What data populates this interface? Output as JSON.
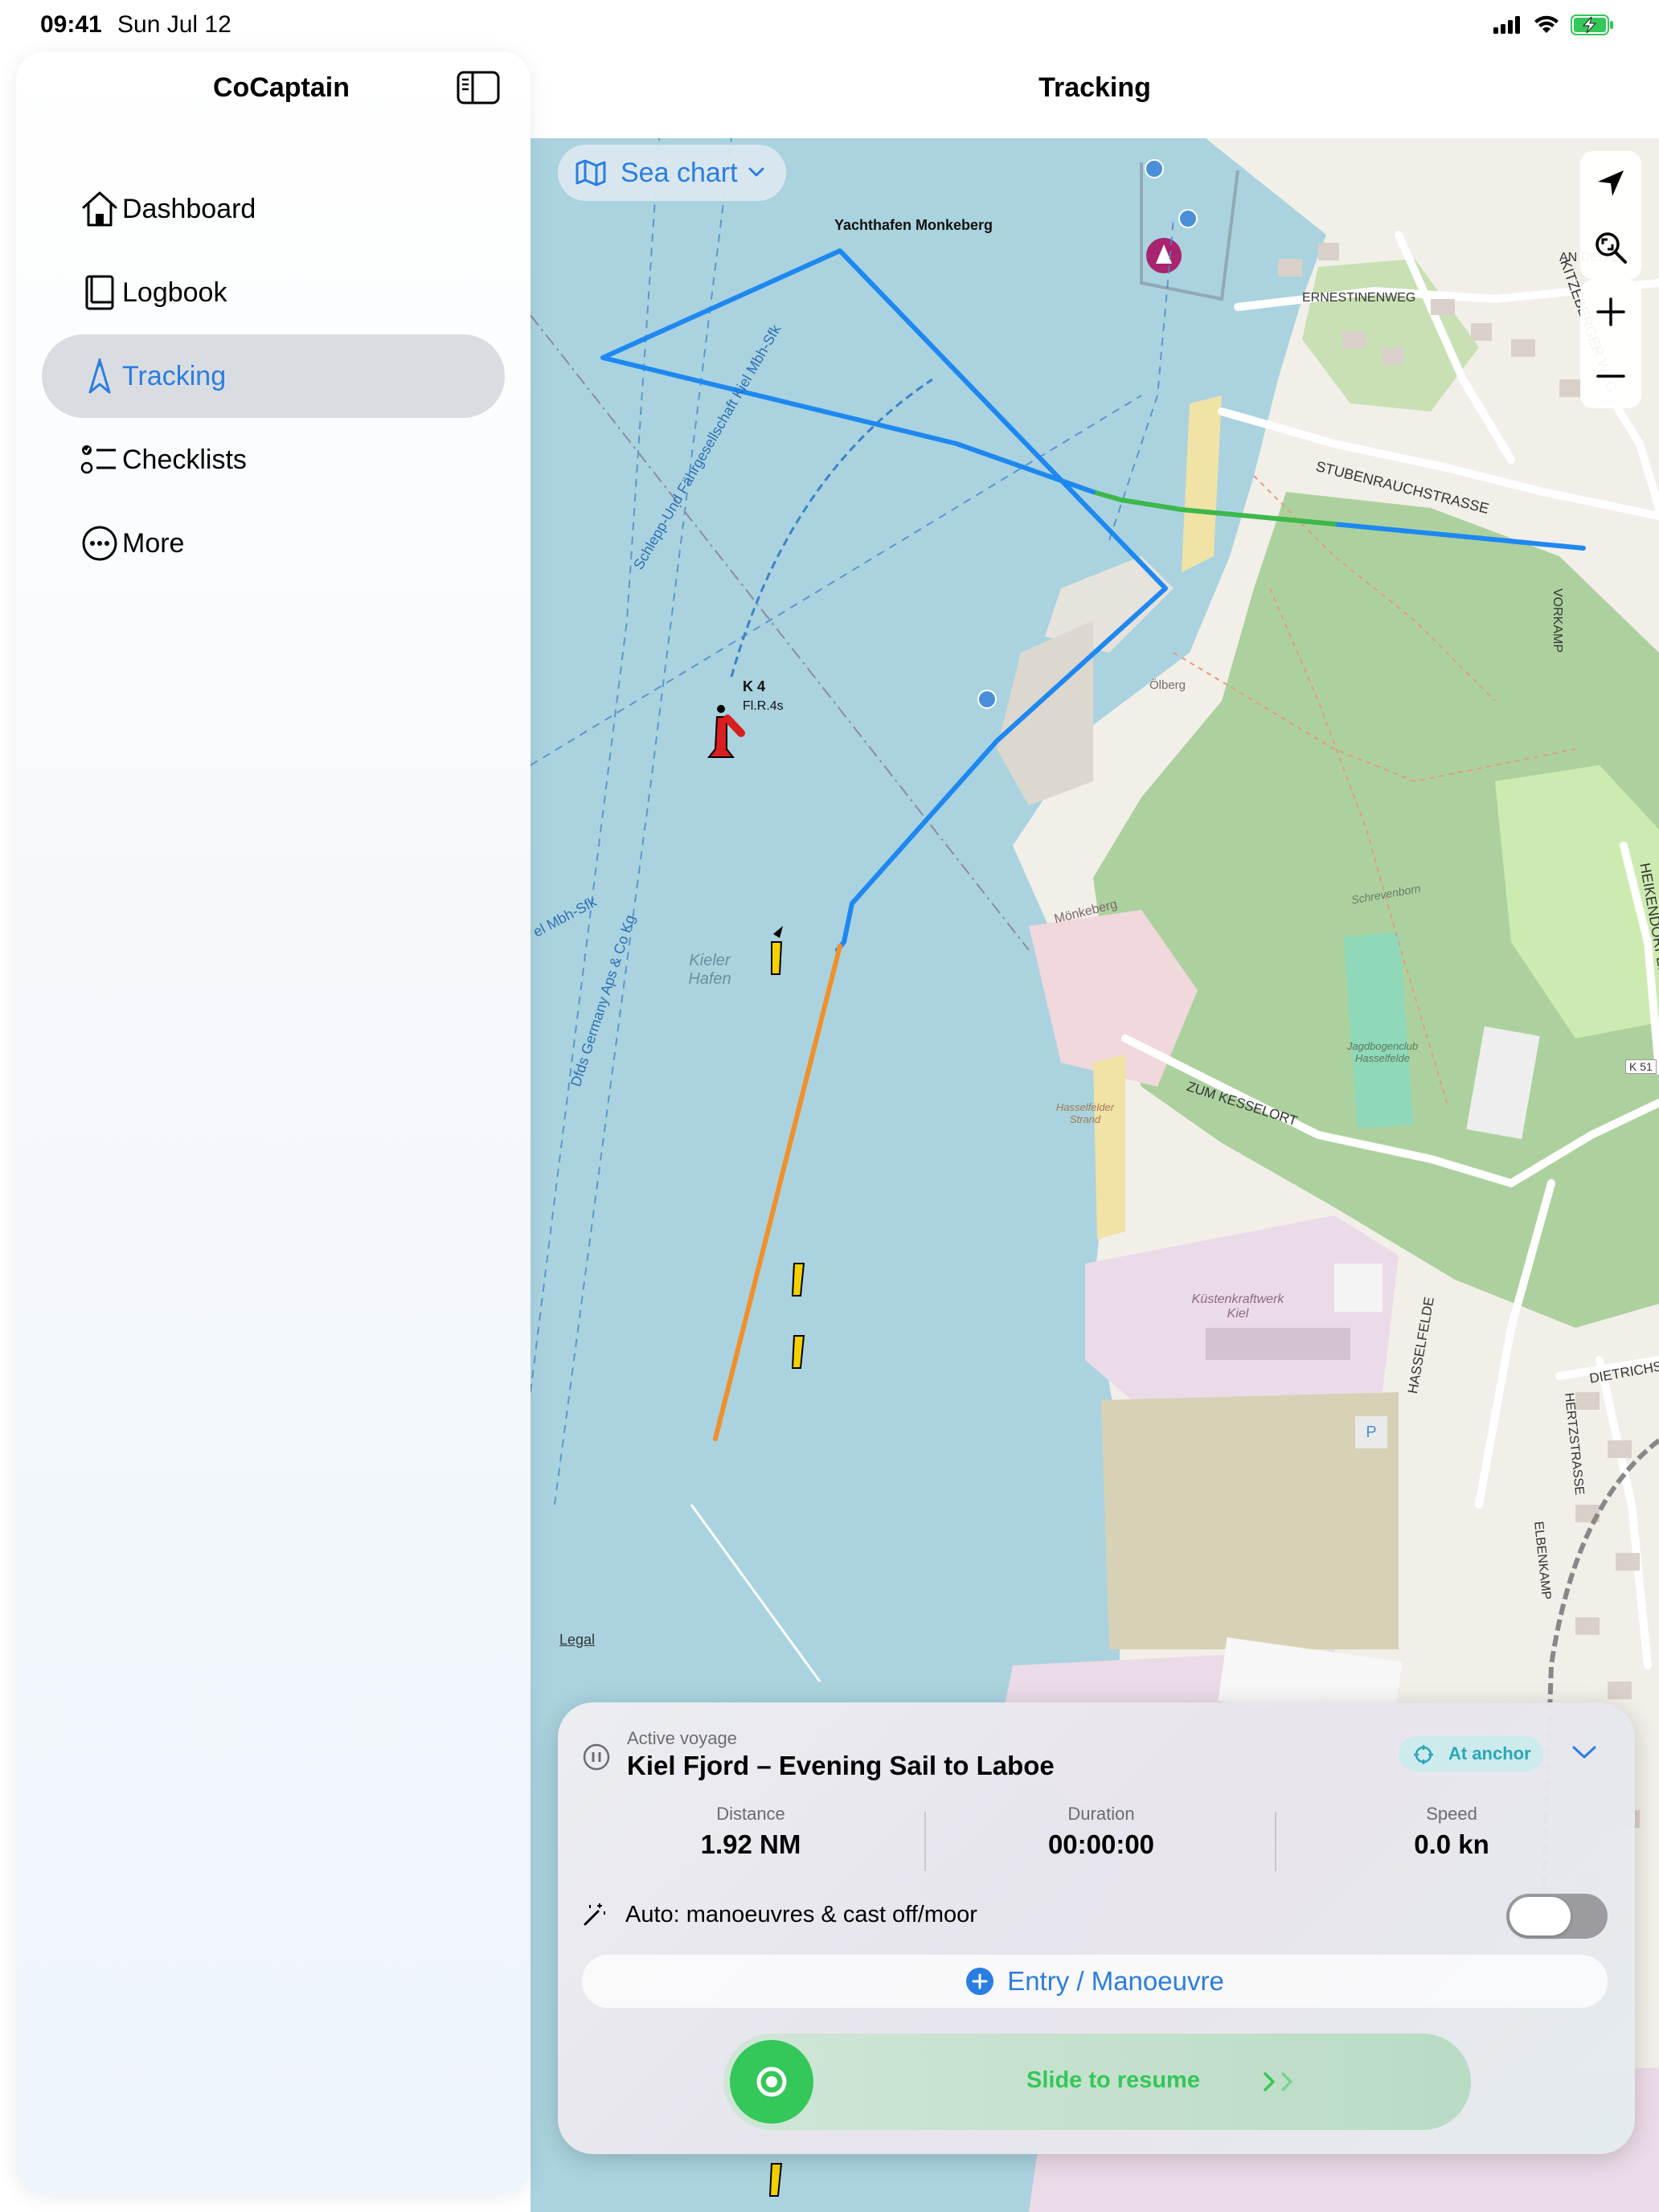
{
  "status": {
    "time": "09:41",
    "date": "Sun Jul 12"
  },
  "sidebar": {
    "title": "CoCaptain",
    "items": [
      {
        "label": "Dashboard",
        "icon": "house-icon"
      },
      {
        "label": "Logbook",
        "icon": "book-icon"
      },
      {
        "label": "Tracking",
        "icon": "tracking-arrow-icon",
        "active": true
      },
      {
        "label": "Checklists",
        "icon": "checklist-icon"
      },
      {
        "label": "More",
        "icon": "ellipsis-circle-icon"
      }
    ]
  },
  "content": {
    "title": "Tracking"
  },
  "map": {
    "layer_label": "Sea chart",
    "legal": "Legal",
    "labels": {
      "marina": "Yachthafen Monkeberg",
      "buoy": "K 4",
      "buoy_light": "Fl.R.4s",
      "harbor": "Kieler Hafen",
      "harbor_line1": "Kieler",
      "harbor_line2": "Hafen",
      "ferry_route": "Schlepp-Und Fährgesellschaft Kiel Mbh-Sfk",
      "ferry_route2": "el Mbh-Sfk",
      "dfds_route": "Dfds Germany Aps & Co Kg",
      "street_stubenrauch": "STUBENRAUCHSTRASSE",
      "street_ernestinenweg": "ERNESTINENWEG",
      "street_kitzeberger": "KITZEBERGER WEG",
      "street_heikendorfer": "HEIKENDORFER WEG",
      "street_kesselort": "ZUM KESSELORT",
      "street_hasselfelde": "HASSELFELDE",
      "street_dietrichs": "DIETRICHS",
      "street_hertz": "HERTZSTRASSE",
      "street_elbenkamp": "ELBENKAMP",
      "street_vorkamp": "VORKAMP",
      "street_an_den_eichen": "AN DEN EI",
      "place_monkeberg": "Mönkeberg",
      "place_olberg": "Ölberg",
      "place_kraftwerk": "Küstenkraftwerk Kiel",
      "place_strand": "Hasselfelder Strand",
      "place_jagd": "Jagdbogenclub Hasselfelde",
      "place_schrevenborn": "Schrevenborn",
      "road_k51": "K 51",
      "parking": "P"
    },
    "track_colors": {
      "blue": "#1e88f0",
      "green": "#3cb84a",
      "orange": "#f0902c"
    }
  },
  "voyage": {
    "kicker": "Active voyage",
    "title": "Kiel Fjord – Evening Sail to Laboe",
    "status_badge": "At anchor",
    "stats": [
      {
        "label": "Distance",
        "value": "1.92 NM"
      },
      {
        "label": "Duration",
        "value": "00:00:00"
      },
      {
        "label": "Speed",
        "value": "0.0 kn"
      }
    ],
    "auto_label": "Auto: manoeuvres & cast off/moor",
    "auto_enabled": false,
    "entry_button": "Entry / Manoeuvre",
    "slider_label": "Slide to resume"
  }
}
